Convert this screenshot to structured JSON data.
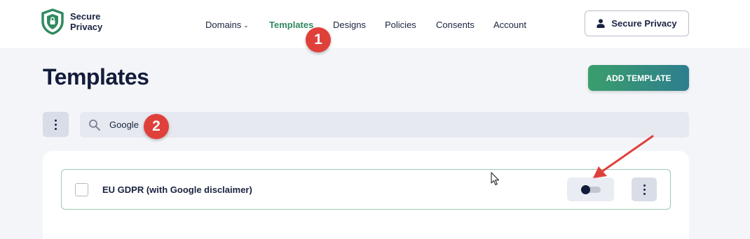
{
  "brand": {
    "name_line1": "Secure",
    "name_line2": "Privacy",
    "logo_icon": "shield-lock-icon",
    "accent_color": "#2f8a5f"
  },
  "nav": {
    "items": [
      {
        "label": "Domains",
        "has_dropdown": true
      },
      {
        "label": "Templates",
        "active": true
      },
      {
        "label": "Designs"
      },
      {
        "label": "Policies"
      },
      {
        "label": "Consents"
      },
      {
        "label": "Account"
      }
    ]
  },
  "user_button": {
    "label": "Secure Privacy",
    "icon": "user-icon"
  },
  "page": {
    "title": "Templates"
  },
  "add_template": {
    "label": "ADD TEMPLATE"
  },
  "search": {
    "value": "Google",
    "icon": "search-icon"
  },
  "templates": [
    {
      "name": "EU GDPR (with Google disclaimer)",
      "enabled": false
    }
  ],
  "annotations": {
    "step1": "1",
    "step2": "2",
    "badge_color": "#e0403a"
  }
}
